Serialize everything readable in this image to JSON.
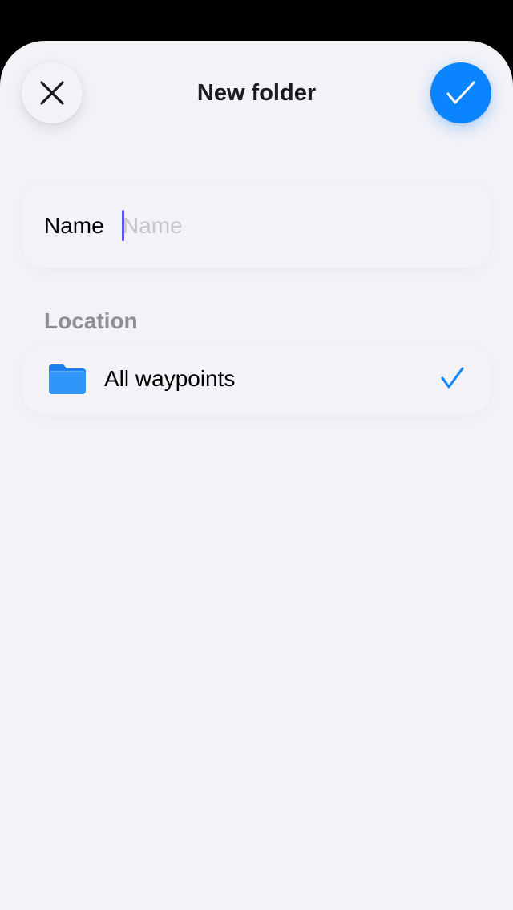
{
  "header": {
    "title": "New folder",
    "close_icon": "close-icon",
    "confirm_icon": "checkmark-icon"
  },
  "name_field": {
    "label": "Name",
    "value": "",
    "placeholder": "Name"
  },
  "location": {
    "section_label": "Location",
    "items": [
      {
        "label": "All waypoints",
        "icon": "folder-icon",
        "selected": true
      }
    ]
  },
  "colors": {
    "accent": "#0a84ff",
    "background": "#f2f2f7",
    "caret": "#5a55e6",
    "secondary_text": "#8e8e93",
    "placeholder_text": "#c7c7cc"
  }
}
